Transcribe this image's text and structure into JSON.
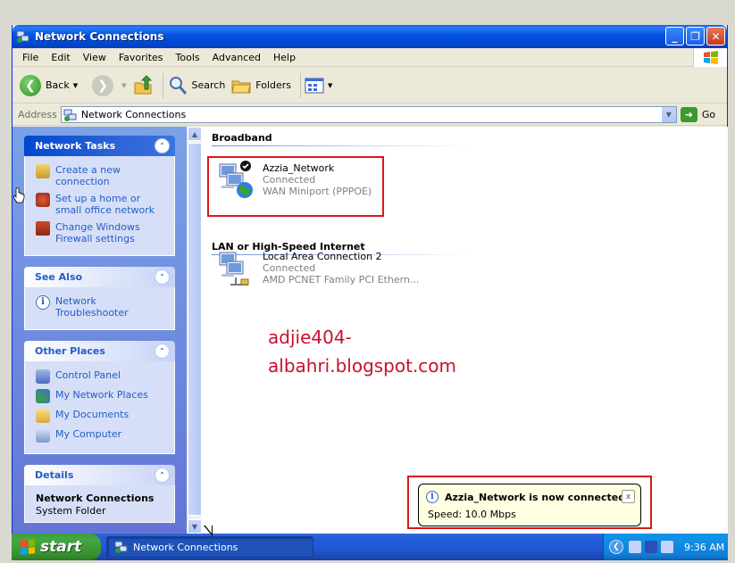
{
  "window": {
    "title": "Network Connections",
    "controls": {
      "minimize": "_",
      "maximize": "❐",
      "close": "✕"
    }
  },
  "menu": [
    "File",
    "Edit",
    "View",
    "Favorites",
    "Tools",
    "Advanced",
    "Help"
  ],
  "toolbar": {
    "back": "Back",
    "search": "Search",
    "folders": "Folders"
  },
  "address": {
    "label": "Address",
    "value": "Network Connections",
    "go": "Go"
  },
  "left_panel": {
    "network_tasks": {
      "title": "Network Tasks",
      "items": [
        "Create a new connection",
        "Set up a home or small office network",
        "Change Windows Firewall settings"
      ]
    },
    "see_also": {
      "title": "See Also",
      "items": [
        "Network Troubleshooter"
      ]
    },
    "other_places": {
      "title": "Other Places",
      "items": [
        "Control Panel",
        "My Network Places",
        "My Documents",
        "My Computer"
      ]
    },
    "details": {
      "title": "Details",
      "name": "Network Connections",
      "type": "System Folder"
    }
  },
  "content": {
    "broadband": {
      "heading": "Broadband",
      "connection": {
        "name": "Azzia_Network",
        "status": "Connected",
        "device": "WAN Miniport (PPPOE)"
      }
    },
    "lan": {
      "heading": "LAN or High-Speed Internet",
      "connection": {
        "name": "Local Area Connection 2",
        "status": "Connected",
        "device": "AMD PCNET Family PCI Ethern..."
      }
    },
    "watermark": [
      "adjie404-",
      "albahri.blogspot.com"
    ]
  },
  "balloon": {
    "title": "Azzia_Network is now connected",
    "body": "Speed: 10.0 Mbps",
    "close": "x"
  },
  "taskbar": {
    "start": "start",
    "task": "Network Connections",
    "clock": "9:36 AM"
  },
  "colors": {
    "titlebar": "#0053e1",
    "highlight_box": "#d81818",
    "watermark": "#c8102e",
    "link": "#215dc6"
  }
}
